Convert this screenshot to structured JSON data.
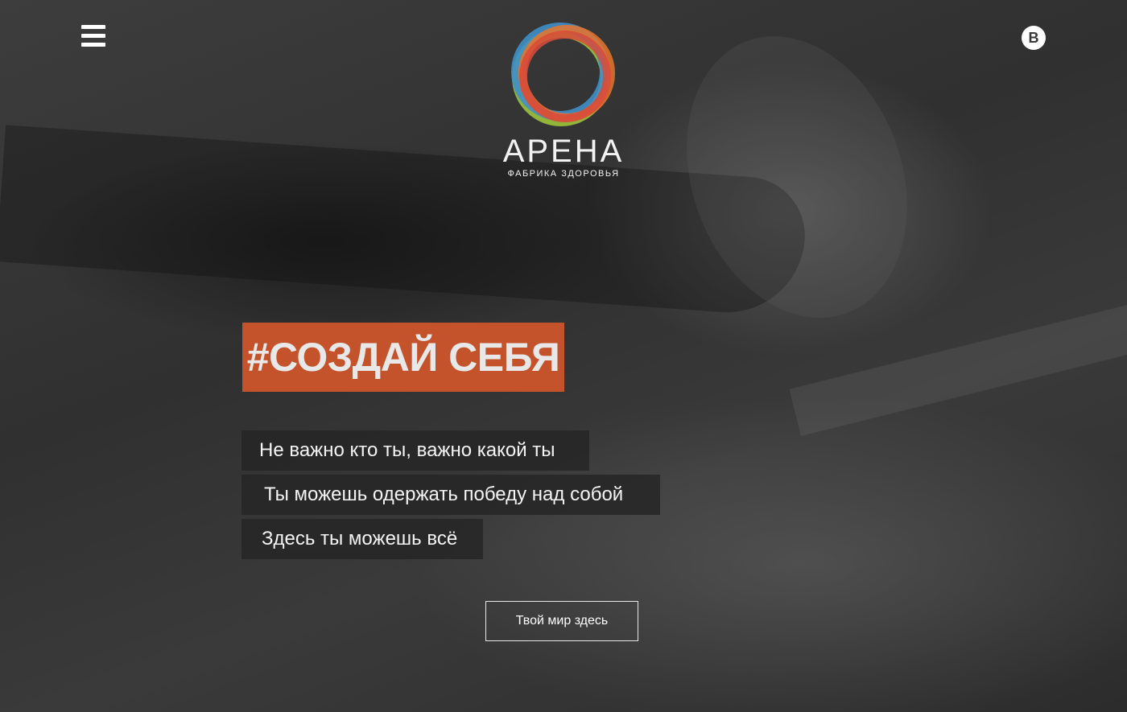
{
  "header": {
    "menu_icon": "hamburger-menu-icon",
    "social_icon": "vk-icon",
    "social_label": "B"
  },
  "logo": {
    "name": "АРЕНА",
    "tagline": "ФАБРИКА ЗДОРОВЬЯ",
    "ring_colors": [
      "#d84a3a",
      "#3f8fc8",
      "#9cc23a",
      "#e8742a"
    ]
  },
  "hero": {
    "headline": "#СОЗДАЙ СЕБЯ",
    "headline_bg": "#c4532c",
    "lines": [
      "Не важно кто ты, важно какой ты",
      "Ты можешь одержать победу над собой",
      "Здесь ты можешь всё"
    ],
    "cta_label": "Твой мир здесь"
  }
}
